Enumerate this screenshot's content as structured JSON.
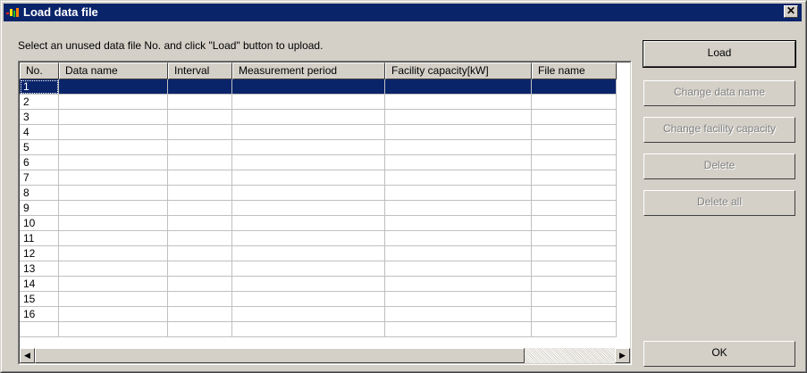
{
  "window": {
    "title": "Load data file",
    "close_glyph": "✕"
  },
  "instruction": "Select an unused data file No. and click \"Load\" button to upload.",
  "table": {
    "columns": [
      "No.",
      "Data name",
      "Interval",
      "Measurement period",
      "Facility capacity[kW]",
      "File name"
    ],
    "rows": [
      "1",
      "2",
      "3",
      "4",
      "5",
      "6",
      "7",
      "8",
      "9",
      "10",
      "11",
      "12",
      "13",
      "14",
      "15",
      "16"
    ],
    "selected_row": "1"
  },
  "buttons": {
    "load": "Load",
    "change_data_name": "Change data name",
    "change_facility_capacity": "Change facility capacity",
    "delete": "Delete",
    "delete_all": "Delete all",
    "ok": "OK"
  },
  "colors": {
    "titlebar": "#0a246a",
    "face": "#d4d0c8",
    "selection": "#0a246a"
  },
  "icons": {
    "app": "app-chart-icon",
    "close": "close-icon",
    "scroll_left": "arrow-left-icon",
    "scroll_right": "arrow-right-icon"
  }
}
